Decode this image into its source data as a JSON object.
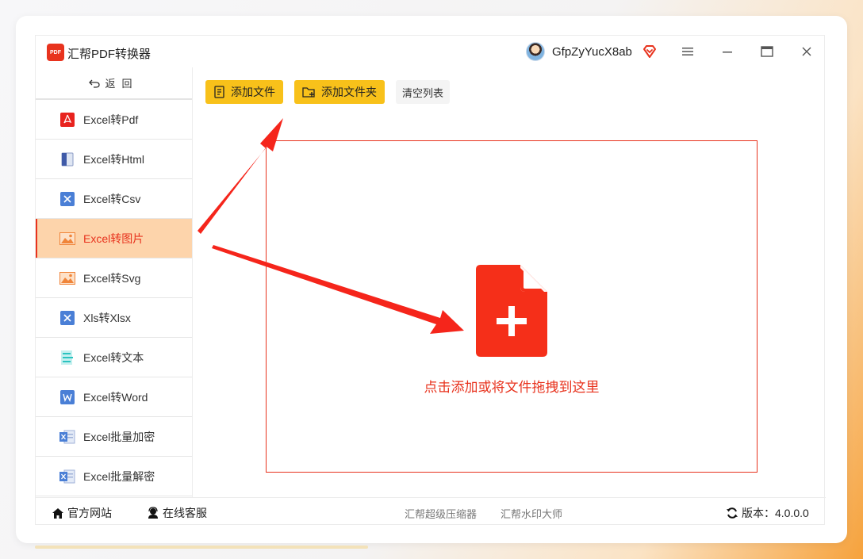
{
  "app": {
    "title": "汇帮PDF转换器",
    "logo_text": "PDF"
  },
  "user": {
    "name": "GfpZyYucX8ab"
  },
  "sidebar": {
    "back_label": "返回",
    "items": [
      {
        "label": "Excel转Pdf",
        "icon": "pdf-icon"
      },
      {
        "label": "Excel转Html",
        "icon": "html-icon"
      },
      {
        "label": "Excel转Csv",
        "icon": "csv-icon"
      },
      {
        "label": "Excel转图片",
        "icon": "image-icon",
        "active": true
      },
      {
        "label": "Excel转Svg",
        "icon": "image-icon"
      },
      {
        "label": "Xls转Xlsx",
        "icon": "excel-icon"
      },
      {
        "label": "Excel转文本",
        "icon": "text-icon"
      },
      {
        "label": "Excel转Word",
        "icon": "word-icon"
      },
      {
        "label": "Excel批量加密",
        "icon": "excel-file-icon"
      },
      {
        "label": "Excel批量解密",
        "icon": "excel-file-icon"
      }
    ]
  },
  "toolbar": {
    "add_file": "添加文件",
    "add_folder": "添加文件夹",
    "clear_list": "清空列表"
  },
  "dropzone": {
    "hint": "点击添加或将文件拖拽到这里"
  },
  "footer": {
    "website": "官方网站",
    "service": "在线客服",
    "compress": "汇帮超级压缩器",
    "watermark": "汇帮水印大师",
    "version": "版本：4.0.0.0"
  },
  "colors": {
    "accent": "#e8331e",
    "button": "#f8c11a",
    "active_bg": "#fdd4ab"
  }
}
